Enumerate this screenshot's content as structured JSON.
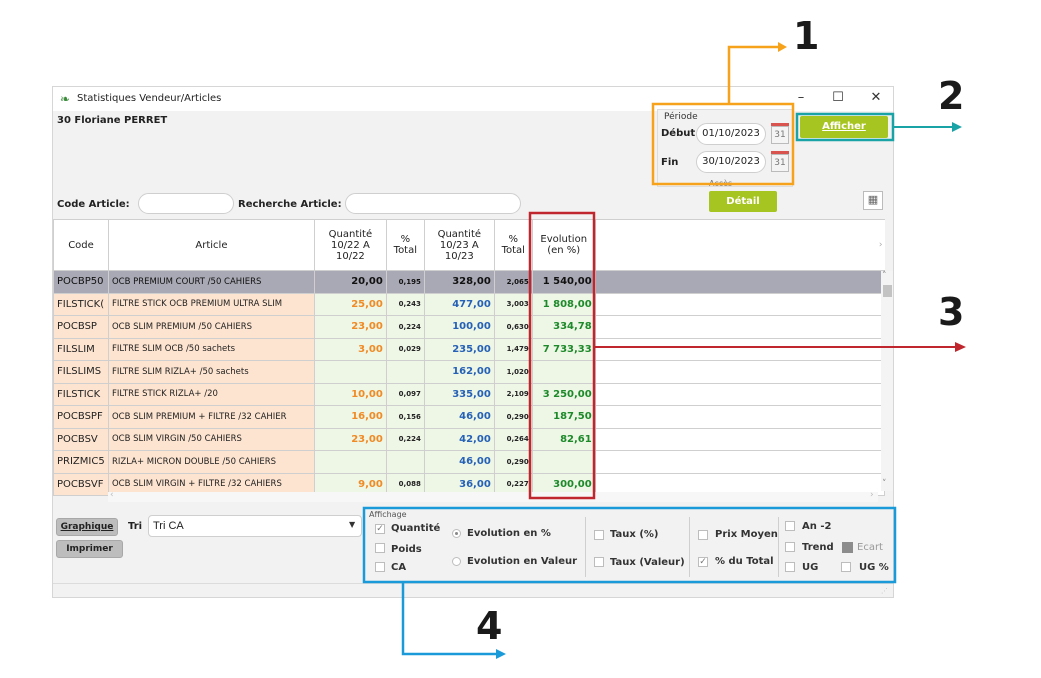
{
  "window": {
    "title": "Statistiques Vendeur/Articles",
    "controls": {
      "minimize": "–",
      "maximize": "☐",
      "close": "✕"
    }
  },
  "seller": "30 Floriane PERRET",
  "filters": {
    "code_label": "Code Article:",
    "search_label": "Recherche Article:",
    "code_value": "",
    "search_value": ""
  },
  "period": {
    "legend": "Période",
    "start_label": "Début",
    "start_value": "01/10/2023",
    "end_label": "Fin",
    "end_value": "30/10/2023",
    "calendar_day": "31"
  },
  "buttons": {
    "afficher": "Afficher",
    "acces_legend": "Accès",
    "detail": "Détail",
    "graphique": "Graphique",
    "imprimer": "Imprimer"
  },
  "tri": {
    "label": "Tri",
    "selected": "Tri CA"
  },
  "table": {
    "columns": [
      "Code",
      "Article",
      "Quantité 10/22 A 10/22",
      "% Total",
      "Quantité 10/23 A 10/23",
      "% Total",
      "Evolution (en %)"
    ],
    "rows": [
      {
        "code": "POCBP50",
        "article": "OCB PREMIUM COURT /50 CAHIERS",
        "q1": "20,00",
        "p1": "0,195",
        "q2": "328,00",
        "p2": "2,065",
        "ev": "1 540,00"
      },
      {
        "code": "FILSTICK(",
        "article": "FILTRE STICK OCB PREMIUM ULTRA SLIM",
        "q1": "25,00",
        "p1": "0,243",
        "q2": "477,00",
        "p2": "3,003",
        "ev": "1 808,00"
      },
      {
        "code": "POCBSP",
        "article": "OCB SLIM PREMIUM /50 CAHIERS",
        "q1": "23,00",
        "p1": "0,224",
        "q2": "100,00",
        "p2": "0,630",
        "ev": "334,78"
      },
      {
        "code": "FILSLIM",
        "article": "FILTRE SLIM OCB /50 sachets",
        "q1": "3,00",
        "p1": "0,029",
        "q2": "235,00",
        "p2": "1,479",
        "ev": "7 733,33"
      },
      {
        "code": "FILSLIMS",
        "article": "FILTRE SLIM RIZLA+ /50 sachets",
        "q1": "",
        "p1": "",
        "q2": "162,00",
        "p2": "1,020",
        "ev": ""
      },
      {
        "code": "FILSTICK",
        "article": "FILTRE STICK RIZLA+ /20",
        "q1": "10,00",
        "p1": "0,097",
        "q2": "335,00",
        "p2": "2,109",
        "ev": "3 250,00"
      },
      {
        "code": "POCBSPF",
        "article": "OCB SLIM PREMIUM + FILTRE /32 CAHIER",
        "q1": "16,00",
        "p1": "0,156",
        "q2": "46,00",
        "p2": "0,290",
        "ev": "187,50"
      },
      {
        "code": "POCBSV",
        "article": "OCB SLIM VIRGIN /50 CAHIERS",
        "q1": "23,00",
        "p1": "0,224",
        "q2": "42,00",
        "p2": "0,264",
        "ev": "82,61"
      },
      {
        "code": "PRIZMIC5",
        "article": "RIZLA+ MICRON DOUBLE /50 CAHIERS",
        "q1": "",
        "p1": "",
        "q2": "46,00",
        "p2": "0,290",
        "ev": ""
      },
      {
        "code": "POCBSVF",
        "article": "OCB SLIM VIRGIN + FILTRE /32 CAHIERS",
        "q1": "9,00",
        "p1": "0,088",
        "q2": "36,00",
        "p2": "0,227",
        "ev": "300,00"
      }
    ]
  },
  "affichage": {
    "legend": "Affichage",
    "quantite": "Quantité",
    "poids": "Poids",
    "ca": "CA",
    "evol_pct": "Evolution en %",
    "evol_val": "Evolution en  Valeur",
    "taux_pct": "Taux (%)",
    "taux_val": "Taux (Valeur)",
    "prix_moyen": "Prix Moyen",
    "pct_total": "% du Total",
    "an2": "An -2",
    "trend": "Trend",
    "ecart": "Ecart",
    "ug": "UG",
    "ug_pct": "UG %"
  },
  "annotations": {
    "n1": "1",
    "n2": "2",
    "n3": "3",
    "n4": "4"
  },
  "colors": {
    "orange": "#f7a21b",
    "teal": "#1aa3a6",
    "red": "#c0262d",
    "blue": "#1a9ad9",
    "accent_green": "#a7c520"
  }
}
